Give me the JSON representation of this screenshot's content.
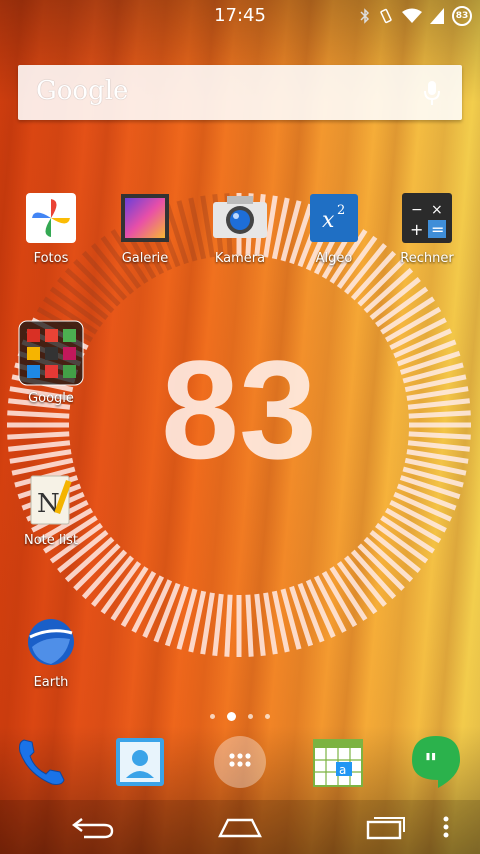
{
  "status_bar": {
    "time": "17:45",
    "icons": [
      "bluetooth-icon",
      "vibrate-icon",
      "wifi-icon",
      "signal-icon",
      "battery-icon"
    ],
    "battery_level": "83"
  },
  "search": {
    "logo": "Google",
    "mic_icon": "microphone-icon"
  },
  "battery_widget": {
    "value": "83",
    "level": 0.83
  },
  "apps": [
    {
      "label": "Fotos",
      "icon": "photos-pinwheel-icon"
    },
    {
      "label": "Galerie",
      "icon": "gallery-icon"
    },
    {
      "label": "Kamera",
      "icon": "camera-icon"
    },
    {
      "label": "Algeo",
      "icon": "algeo-x-squared-icon"
    },
    {
      "label": "Rechner",
      "icon": "calculator-icon"
    },
    {
      "label": "Google",
      "icon": "google-folder-icon"
    },
    {
      "label": "Note list",
      "icon": "notepad-icon"
    },
    {
      "label": "Earth",
      "icon": "google-earth-icon"
    }
  ],
  "pages": {
    "count": 4,
    "active": 1
  },
  "dock": [
    "phone-icon",
    "contacts-icon",
    "all-apps-icon",
    "calendar-icon",
    "hangouts-icon"
  ],
  "nav": [
    "back-icon",
    "home-icon",
    "recents-icon",
    "overflow-menu-icon"
  ],
  "colors": {
    "accent": "#f06a1c",
    "hangouts": "#2bb24c",
    "phone": "#1a73e8"
  }
}
